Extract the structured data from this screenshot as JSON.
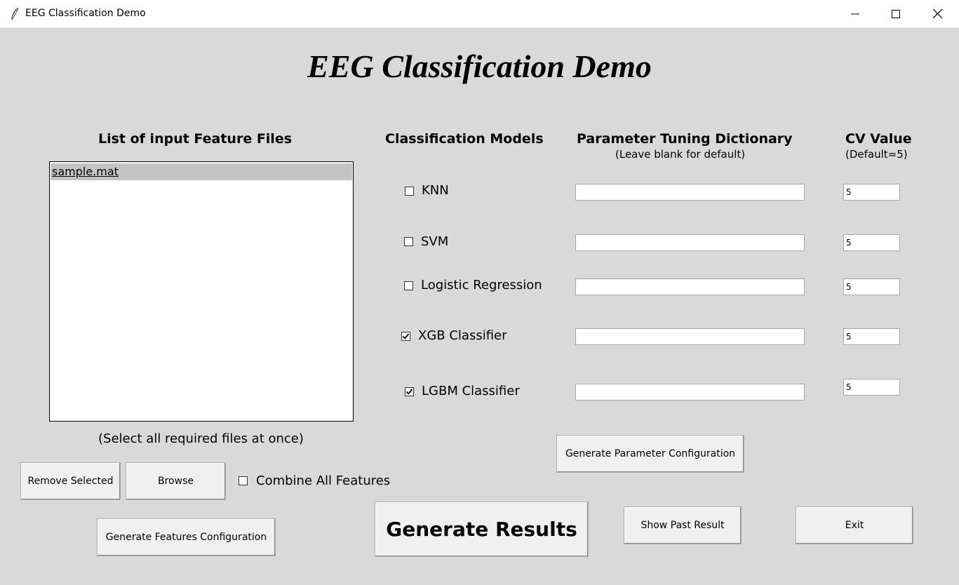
{
  "window": {
    "title": "EEG Classification Demo"
  },
  "heading": "EEG Classification Demo",
  "files": {
    "header": "List of input Feature Files",
    "items": [
      "sample.mat"
    ],
    "hint": "(Select all required files at once)",
    "remove_label": "Remove Selected",
    "browse_label": "Browse",
    "combine_label": "Combine All Features",
    "combine_checked": false,
    "generate_features_label": "Generate Features Configuration"
  },
  "models": {
    "header": "Classification Models",
    "param_header": "Parameter Tuning Dictionary",
    "param_subheader": "(Leave blank for default)",
    "cv_header": "CV Value",
    "cv_subheader": "(Default=5)",
    "rows": [
      {
        "name": "KNN",
        "checked": false,
        "params": "",
        "cv": "5"
      },
      {
        "name": "SVM",
        "checked": false,
        "params": "",
        "cv": "5"
      },
      {
        "name": "Logistic Regression",
        "checked": false,
        "params": "",
        "cv": "5"
      },
      {
        "name": "XGB Classifier",
        "checked": true,
        "params": "",
        "cv": "5"
      },
      {
        "name": "LGBM Classifier",
        "checked": true,
        "params": "",
        "cv": "5"
      }
    ],
    "generate_param_label": "Generate Parameter Configuration"
  },
  "actions": {
    "generate_results_label": "Generate Results",
    "show_past_label": "Show Past Result",
    "exit_label": "Exit"
  }
}
